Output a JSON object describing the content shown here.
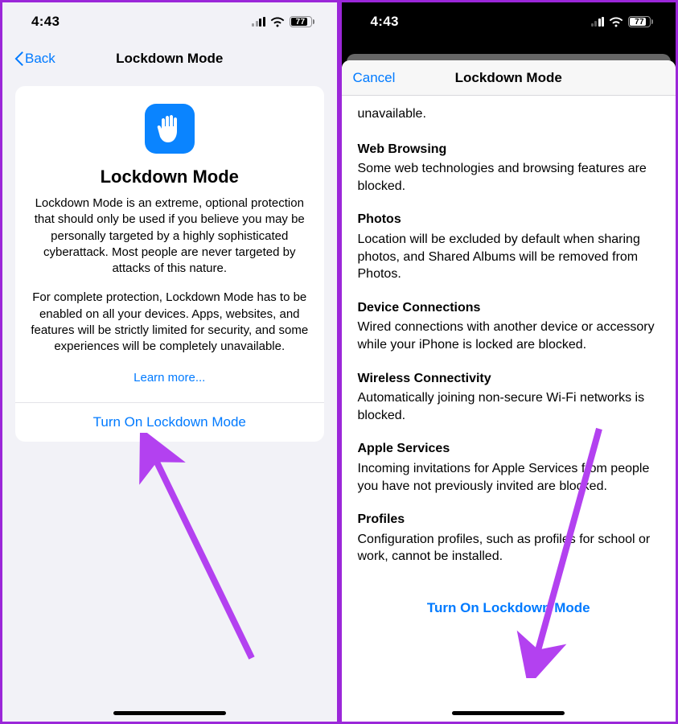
{
  "status": {
    "time": "4:43",
    "battery_pct": "77",
    "battery_fill_pct": 77
  },
  "left": {
    "nav_back": "Back",
    "nav_title": "Lockdown Mode",
    "card_title": "Lockdown Mode",
    "card_para1": "Lockdown Mode is an extreme, optional protection that should only be used if you believe you may be personally targeted by a highly sophisticated cyberattack. Most people are never targeted by attacks of this nature.",
    "card_para2": "For complete protection, Lockdown Mode has to be enabled on all your devices. Apps, websites, and features will be strictly limited for security, and some experiences will be completely unavailable.",
    "learn_more": "Learn more...",
    "turn_on": "Turn On Lockdown Mode"
  },
  "right": {
    "nav_cancel": "Cancel",
    "nav_title": "Lockdown Mode",
    "frag": "unavailable.",
    "sections": [
      {
        "head": "Web Browsing",
        "body": "Some web technologies and browsing features are blocked."
      },
      {
        "head": "Photos",
        "body": "Location will be excluded by default when sharing photos, and Shared Albums will be removed from Photos."
      },
      {
        "head": "Device Connections",
        "body": "Wired connections with another device or accessory while your iPhone is locked are blocked."
      },
      {
        "head": "Wireless Connectivity",
        "body": "Automatically joining non-secure Wi-Fi networks is blocked."
      },
      {
        "head": "Apple Services",
        "body": "Incoming invitations for Apple Services from people you have not previously invited are blocked."
      },
      {
        "head": "Profiles",
        "body": "Configuration profiles, such as profiles for school or work, cannot be installed."
      }
    ],
    "turn_on": "Turn On Lockdown Mode"
  }
}
